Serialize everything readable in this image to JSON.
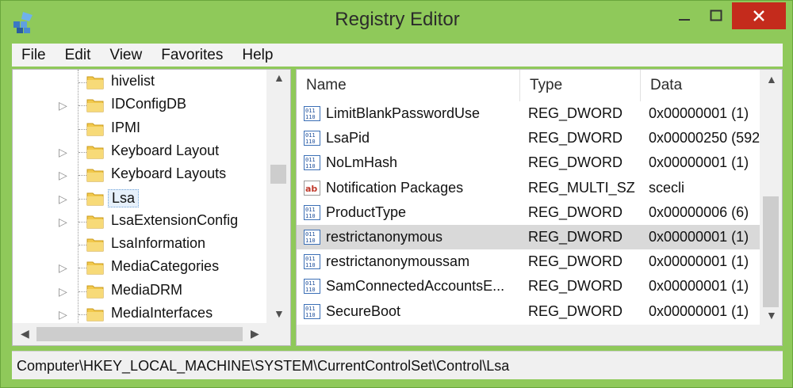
{
  "window": {
    "title": "Registry Editor"
  },
  "menu": [
    "File",
    "Edit",
    "View",
    "Favorites",
    "Help"
  ],
  "tree": {
    "items": [
      {
        "label": "hivelist",
        "expandable": false
      },
      {
        "label": "IDConfigDB",
        "expandable": true
      },
      {
        "label": "IPMI",
        "expandable": false
      },
      {
        "label": "Keyboard Layout",
        "expandable": true
      },
      {
        "label": "Keyboard Layouts",
        "expandable": true
      },
      {
        "label": "Lsa",
        "expandable": true,
        "selected": true
      },
      {
        "label": "LsaExtensionConfig",
        "expandable": true
      },
      {
        "label": "LsaInformation",
        "expandable": false
      },
      {
        "label": "MediaCategories",
        "expandable": true
      },
      {
        "label": "MediaDRM",
        "expandable": true
      },
      {
        "label": "MediaInterfaces",
        "expandable": true
      }
    ]
  },
  "list": {
    "columns": {
      "name": "Name",
      "type": "Type",
      "data": "Data"
    },
    "rows": [
      {
        "icon": "binary-value-icon",
        "name": "LimitBlankPasswordUse",
        "type": "REG_DWORD",
        "data": "0x00000001 (1)"
      },
      {
        "icon": "binary-value-icon",
        "name": "LsaPid",
        "type": "REG_DWORD",
        "data": "0x00000250 (592)"
      },
      {
        "icon": "binary-value-icon",
        "name": "NoLmHash",
        "type": "REG_DWORD",
        "data": "0x00000001 (1)"
      },
      {
        "icon": "string-value-icon",
        "name": "Notification Packages",
        "type": "REG_MULTI_SZ",
        "data": "scecli"
      },
      {
        "icon": "binary-value-icon",
        "name": "ProductType",
        "type": "REG_DWORD",
        "data": "0x00000006 (6)"
      },
      {
        "icon": "binary-value-icon",
        "name": "restrictanonymous",
        "type": "REG_DWORD",
        "data": "0x00000001 (1)",
        "selected": true
      },
      {
        "icon": "binary-value-icon",
        "name": "restrictanonymoussam",
        "type": "REG_DWORD",
        "data": "0x00000001 (1)"
      },
      {
        "icon": "binary-value-icon",
        "name": "SamConnectedAccountsE...",
        "type": "REG_DWORD",
        "data": "0x00000001 (1)"
      },
      {
        "icon": "binary-value-icon",
        "name": "SecureBoot",
        "type": "REG_DWORD",
        "data": "0x00000001 (1)"
      }
    ]
  },
  "status": {
    "path": "Computer\\HKEY_LOCAL_MACHINE\\SYSTEM\\CurrentControlSet\\Control\\Lsa"
  },
  "colors": {
    "frame": "#8fc95a",
    "close_button": "#c42b1c",
    "selection": "#d9d9d9",
    "folder": "#f2c94c"
  }
}
